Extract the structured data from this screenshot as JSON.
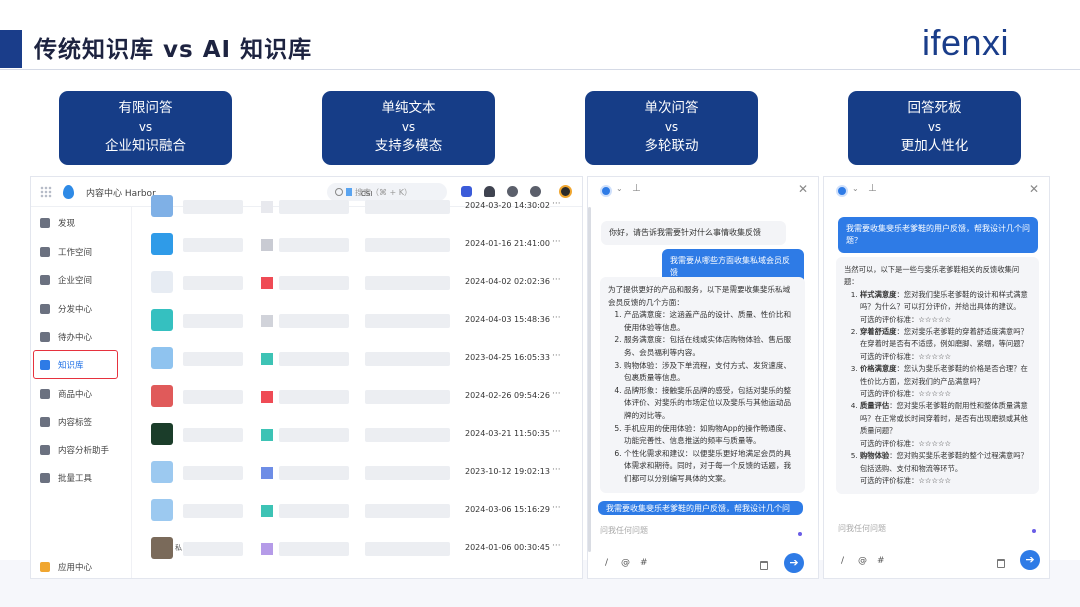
{
  "slide": {
    "title": "传统知识库 vs  AI 知识库",
    "logo": "ifenxi"
  },
  "comparisons": [
    {
      "top": "有限问答",
      "vs": "vs",
      "bottom": "企业知识融合"
    },
    {
      "top": "单纯文本",
      "vs": "vs",
      "bottom": "支持多模态"
    },
    {
      "top": "单次问答",
      "vs": "vs",
      "bottom": "多轮联动"
    },
    {
      "top": "回答死板",
      "vs": "vs",
      "bottom": "更加人性化"
    }
  ],
  "app": {
    "name": "内容中心 Harbor",
    "search_placeholder": "搜索（⌘ + K）",
    "nav": [
      {
        "label": "发现",
        "icon": "discover-icon"
      },
      {
        "label": "工作空间",
        "icon": "workspace-icon"
      },
      {
        "label": "企业空间",
        "icon": "enterprise-icon"
      },
      {
        "label": "分发中心",
        "icon": "distribute-icon"
      },
      {
        "label": "待办中心",
        "icon": "todo-icon"
      },
      {
        "label": "知识库",
        "icon": "knowledge-icon"
      },
      {
        "label": "商品中心",
        "icon": "product-icon"
      },
      {
        "label": "内容标签",
        "icon": "tag-icon"
      },
      {
        "label": "内容分析助手",
        "icon": "analysis-icon"
      },
      {
        "label": "批量工具",
        "icon": "batch-icon"
      }
    ],
    "app_center": "应用中心",
    "list_rows": [
      {
        "date": "2024-03-20 14:30:02",
        "extra": "CSI",
        "thumb": "#7fb0e6",
        "tag": "#e8e9ee"
      },
      {
        "date": "2024-01-16 21:41:00",
        "extra": "",
        "thumb": "#2f9be8",
        "tag": "#c9cbd3"
      },
      {
        "date": "2024-04-02 02:02:36",
        "extra": "",
        "thumb": "#e7ecf3",
        "tag": "#ef4b55"
      },
      {
        "date": "2024-04-03 15:48:36",
        "extra": "",
        "thumb": "#35c0c0",
        "tag": "#d1d3da"
      },
      {
        "date": "2023-04-25 16:05:33",
        "extra": "",
        "thumb": "#8fc3ef",
        "tag": "#3dc3b5"
      },
      {
        "date": "2024-02-26 09:54:26",
        "extra": "",
        "thumb": "#e05a5a",
        "tag": "#ef4b55"
      },
      {
        "date": "2024-03-21 11:50:35",
        "extra": "",
        "thumb": "#1b3d2a",
        "tag": "#3dc3b5"
      },
      {
        "date": "2023-10-12 19:02:13",
        "extra": "",
        "thumb": "#9cc9f0",
        "tag": "#6e8de6"
      },
      {
        "date": "2024-03-06 15:16:29",
        "extra": "",
        "thumb": "#9cc9f0",
        "tag": "#3dc3b5"
      },
      {
        "date": "2024-01-06 00:30:45",
        "extra": "私",
        "thumb": "#7a6a5a",
        "tag": "#b59be8"
      }
    ],
    "more": "···"
  },
  "chat1": {
    "q": "你好，请告诉我需要针对什么事情收集反馈",
    "user": "我需要从哪些方面收集私域会员反馈",
    "intro": "为了提供更好的产品和服务，以下是需要收集斐乐私域会员反馈的几个方面：",
    "items": [
      "产品满意度：这涵盖产品的设计、质量、性价比和使用体验等信息。",
      "服务满意度：包括在线或实体店购物体验、售后服务、会员福利等内容。",
      "购物体验：涉及下单流程，支付方式、发货速度、包裹质量等信息。",
      "品牌形象：接触斐乐品牌的感受，包括对斐乐的整体评价、对斐乐的市场定位以及斐乐与其他运动品牌的对比等。",
      "手机应用的使用体验：如购物App的操作畅通度、功能完善性、信息推送的频率与质量等。",
      "个性化需求和建议：以便斐乐更好地满足会员的具体需求和期待。同时，对于每一个反馈的话题，我们都可以分别编写具体的文案。"
    ],
    "user2": "我需要收集斐乐老爹鞋的用户反馈，帮我设计几个问",
    "placeholder": "问我任何问题"
  },
  "chat2": {
    "user": "我需要收集斐乐老爹鞋的用户反馈，帮我设计几个问题？",
    "intro": "当然可以，以下是一些与斐乐老爹鞋相关的反馈收集问题：",
    "items": [
      {
        "key": "样式满意度",
        "text": "：您对我们斐乐老爹鞋的设计和样式满意吗？为什么？可以打分评价，并给出具体的建议。",
        "rate": "可选的评价标准：☆☆☆☆☆"
      },
      {
        "key": "穿着舒适度",
        "text": "：您对斐乐老爹鞋的穿着舒适度满意吗？在穿着时是否有不适感，例如磨脚、紧绷，等问题？",
        "rate": "可选的评价标准：☆☆☆☆☆"
      },
      {
        "key": "价格满意度",
        "text": "：您认为斐乐老爹鞋的价格是否合理？在性价比方面，您对我们的产品满意吗？",
        "rate": "可选的评价标准：☆☆☆☆☆"
      },
      {
        "key": "质量评估",
        "text": "：您对斐乐老爹鞋的耐用性和整体质量满意吗？在正常或长时间穿着时，是否有出现磨损或其他质量问题？",
        "rate": "可选的评价标准：☆☆☆☆☆"
      },
      {
        "key": "购物体验",
        "text": "：您对购买斐乐老爹鞋的整个过程满意吗？包括选购、支付和物流等环节。",
        "rate": "可选的评价标准：☆☆☆☆☆"
      }
    ],
    "placeholder": "问我任何问题"
  },
  "chat_tools": {
    "slash": "/",
    "at": "@",
    "hash": "#",
    "send": "➔",
    "close": "✕",
    "caret": "⌄",
    "pin": "⊥"
  }
}
